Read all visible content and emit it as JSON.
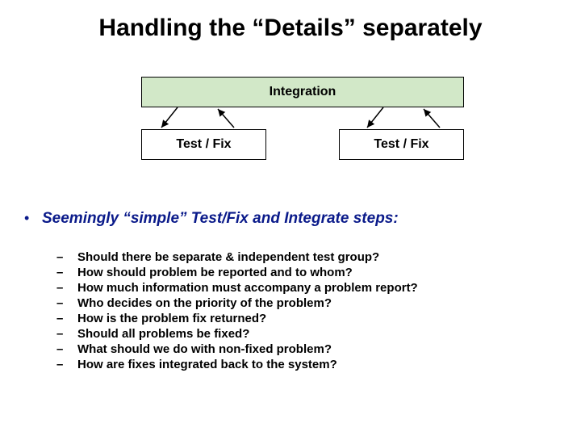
{
  "title": "Handling the “Details” separately",
  "boxes": {
    "integration": "Integration",
    "testfix_left": "Test / Fix",
    "testfix_right": "Test / Fix"
  },
  "lead": {
    "bullet": "•",
    "text": "Seemingly “simple” Test/Fix and Integrate steps:"
  },
  "sub_dash": "–",
  "subs": [
    "Should there be separate & independent test group?",
    "How should problem be reported and to whom?",
    "How much information must accompany a problem report?",
    "Who decides on the priority of the problem?",
    "How is the problem fix returned?",
    "Should all problems be fixed?",
    "What should we do with non-fixed problem?",
    "How are fixes integrated back to the system?"
  ]
}
